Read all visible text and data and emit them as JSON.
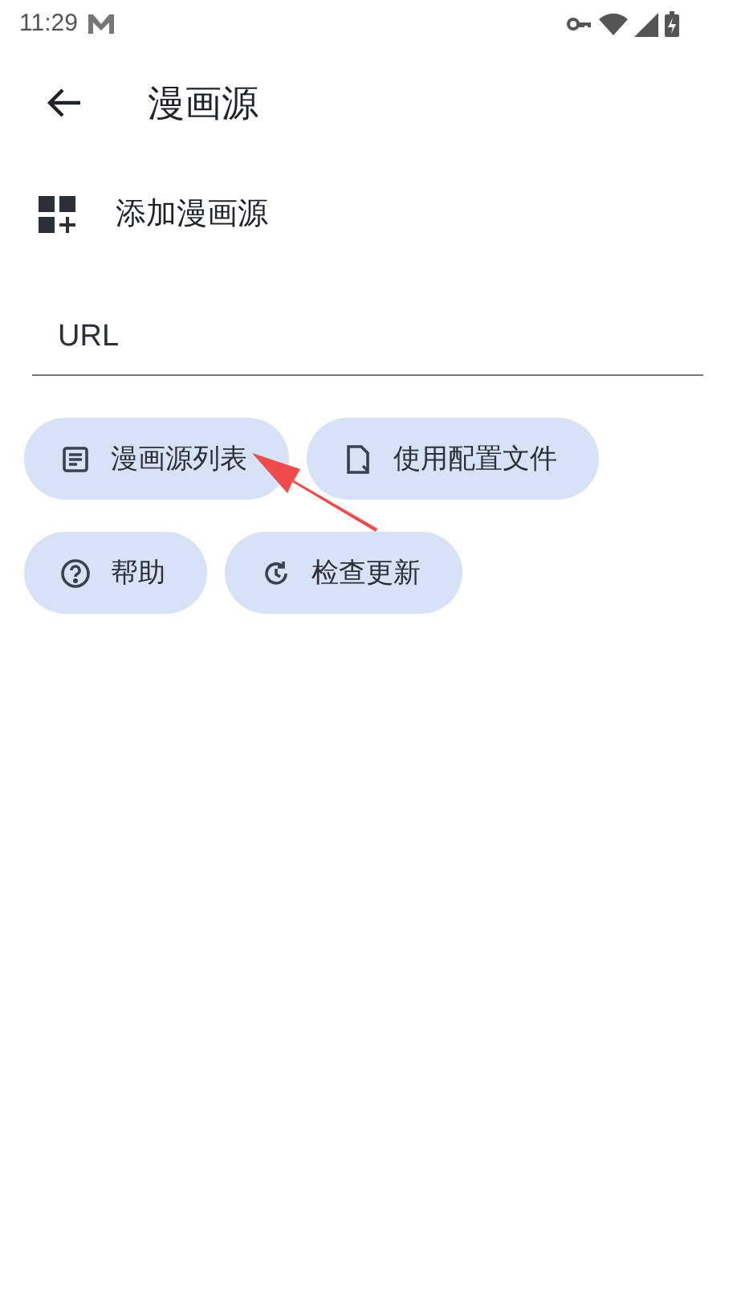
{
  "status_bar": {
    "time": "11:29"
  },
  "app_bar": {
    "title": "漫画源"
  },
  "add_row": {
    "label": "添加漫画源"
  },
  "url_field": {
    "placeholder": "URL"
  },
  "buttons": [
    {
      "kind": "list",
      "label": "漫画源列表"
    },
    {
      "kind": "file",
      "label": "使用配置文件"
    },
    {
      "kind": "help",
      "label": "帮助"
    },
    {
      "kind": "update",
      "label": "检查更新"
    }
  ]
}
